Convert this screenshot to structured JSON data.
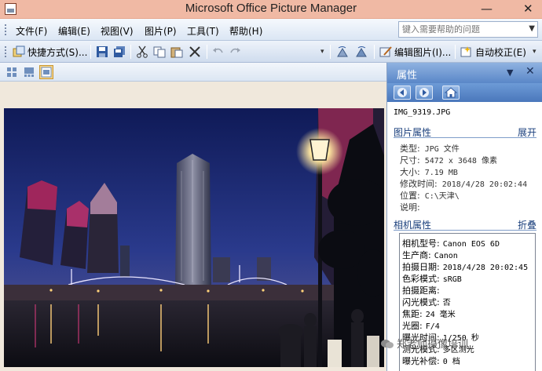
{
  "window": {
    "title": "Microsoft Office Picture Manager",
    "min_glyph": "—",
    "close_glyph": "✕"
  },
  "menu": {
    "items": [
      "文件(F)",
      "编辑(E)",
      "视图(V)",
      "图片(P)",
      "工具(T)",
      "帮助(H)"
    ],
    "help_placeholder": "键入需要帮助的问题"
  },
  "toolbar": {
    "shortcuts_label": "快捷方式(S)...",
    "edit_picture_label": "编辑图片(I)...",
    "auto_correct_label": "自动校正(E)"
  },
  "pane": {
    "title": "属性",
    "file_name": "IMG_9319.JPG",
    "picture_section": {
      "title": "图片属性",
      "action": "展开"
    },
    "picture_props": [
      {
        "label": "类型:",
        "value": "JPG 文件"
      },
      {
        "label": "尺寸:",
        "value": "5472 x 3648 像素"
      },
      {
        "label": "大小:",
        "value": "7.19 MB"
      },
      {
        "label": "修改时间:",
        "value": "2018/4/28 20:02:44"
      },
      {
        "label": "位置:",
        "value": "C:\\天津\\"
      },
      {
        "label": "说明:",
        "value": ""
      }
    ],
    "camera_section": {
      "title": "相机属性",
      "action": "折叠"
    },
    "camera_props": [
      {
        "label": "相机型号:",
        "value": "Canon EOS 6D"
      },
      {
        "label": "生产商:",
        "value": "Canon"
      },
      {
        "label": "拍摄日期:",
        "value": "2018/4/28 20:02:45"
      },
      {
        "label": "色彩模式:",
        "value": "sRGB"
      },
      {
        "label": "拍摄距离:",
        "value": ""
      },
      {
        "label": "闪光模式:",
        "value": "否"
      },
      {
        "label": "焦距:",
        "value": "24 毫米"
      },
      {
        "label": "光圈:",
        "value": "F/4"
      },
      {
        "label": "曝光时间:",
        "value": "1/250 秒"
      },
      {
        "label": "测光模式:",
        "value": "多区测光"
      },
      {
        "label": "曝光补偿:",
        "value": "0 档"
      }
    ]
  },
  "watermark": "郑老师摄像培训",
  "colors": {
    "title_bar": "#f0b9a4",
    "pane_header": "#5a87c8",
    "section_text": "#1a3f7c",
    "active_view": "#f6d48a"
  }
}
